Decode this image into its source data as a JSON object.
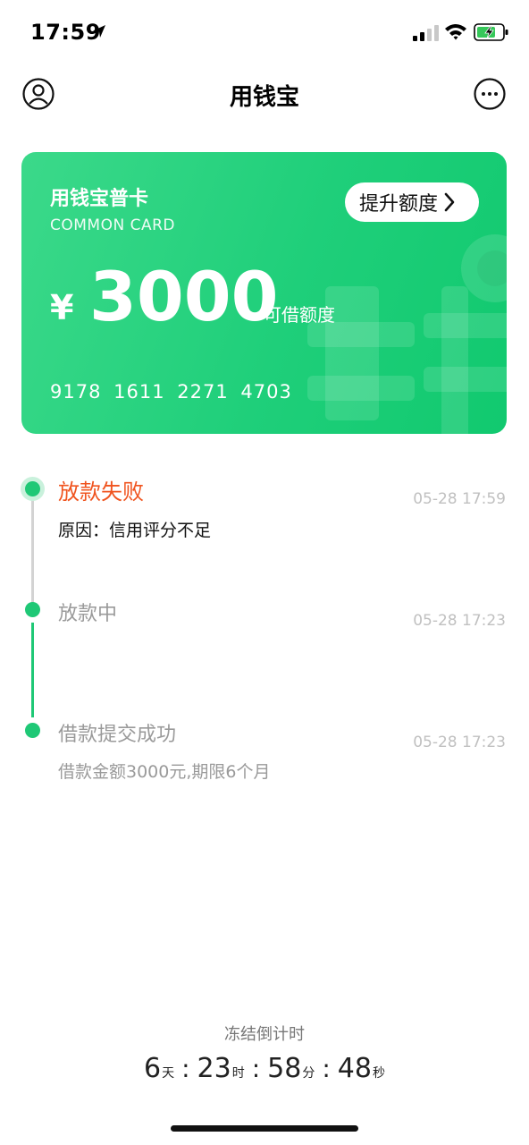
{
  "status_bar": {
    "time": "17:59"
  },
  "nav": {
    "title": "用钱宝"
  },
  "card": {
    "name": "用钱宝普卡",
    "subname": "COMMON CARD",
    "raise_button": "提升额度",
    "currency": "¥",
    "amount": "3000",
    "amount_label": "可借额度",
    "number": "9178 1611 2271 4703"
  },
  "timeline": {
    "steps": [
      {
        "title": "放款失败",
        "time": "05-28 17:59",
        "desc": "原因：信用评分不足"
      },
      {
        "title": "放款中",
        "time": "05-28 17:23"
      },
      {
        "title": "借款提交成功",
        "time": "05-28 17:23",
        "desc": "借款金额3000元,期限6个月"
      }
    ]
  },
  "countdown": {
    "label": "冻结倒计时",
    "days": "6",
    "days_unit": "天",
    "hours": "23",
    "hours_unit": "时",
    "minutes": "58",
    "minutes_unit": "分",
    "seconds": "48",
    "seconds_unit": "秒",
    "separator": ":"
  },
  "colors": {
    "brand_green": "#1fc876",
    "failed_orange": "#f0541f"
  }
}
